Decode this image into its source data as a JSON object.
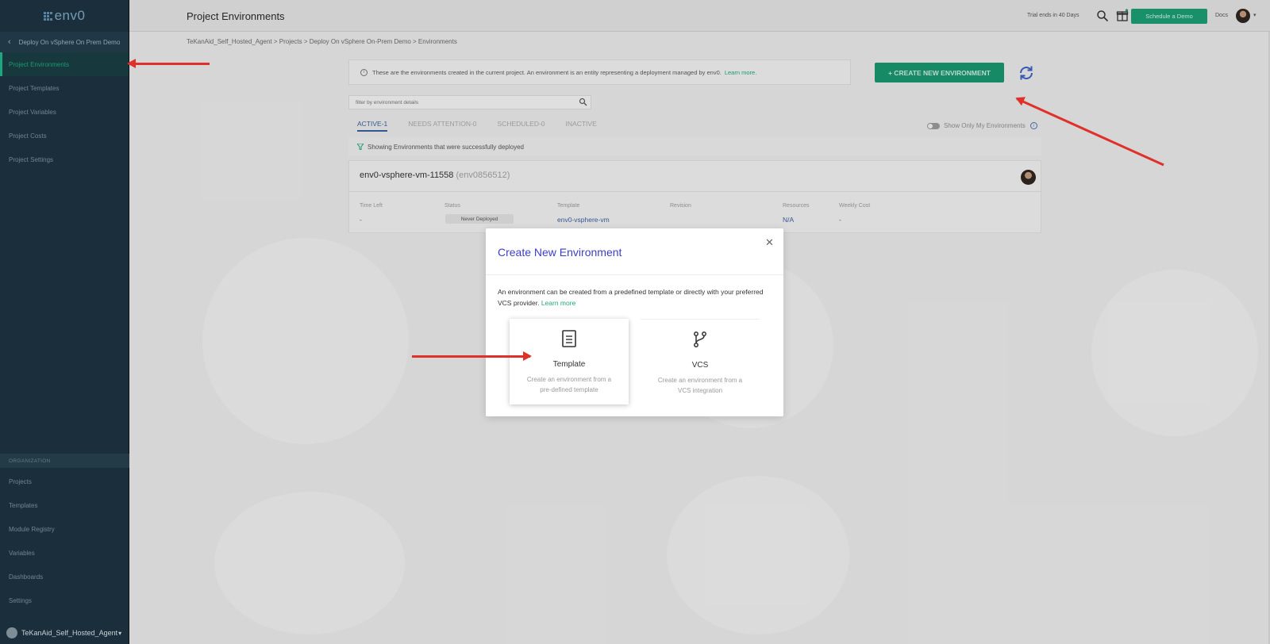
{
  "sidebar": {
    "logo": "env0",
    "project_name": "Deploy On vSphere On Prem Demo",
    "items": [
      {
        "label": "Project Environments",
        "active": true
      },
      {
        "label": "Project Templates"
      },
      {
        "label": "Project Variables"
      },
      {
        "label": "Project Costs"
      },
      {
        "label": "Project Settings"
      }
    ],
    "org_header": "ORGANIZATION",
    "org_items": [
      {
        "label": "Projects"
      },
      {
        "label": "Templates"
      },
      {
        "label": "Module Registry"
      },
      {
        "label": "Variables"
      },
      {
        "label": "Dashboards"
      },
      {
        "label": "Settings"
      }
    ],
    "org_name": "TeKanAid_Self_Hosted_Agent"
  },
  "topbar": {
    "title": "Project Environments",
    "trial_text": "Trial ends in 40 Days",
    "demo_button": "Schedule a Demo",
    "docs_link": "Docs"
  },
  "breadcrumb": "TeKanAid_Self_Hosted_Agent > Projects > Deploy On vSphere On-Prem Demo > Environments",
  "info": {
    "text": "These are the environments created in the current project. An environment is an entity representing a deployment managed by env0.",
    "learn_more": "Learn more."
  },
  "create_button": "+ CREATE NEW ENVIRONMENT",
  "filter": {
    "placeholder": "filter by environment details"
  },
  "tabs": [
    {
      "label": "ACTIVE-1",
      "active": true
    },
    {
      "label": "NEEDS ATTENTION-0"
    },
    {
      "label": "SCHEDULED-0"
    },
    {
      "label": "INACTIVE"
    }
  ],
  "toggle_label": "Show Only My Environments",
  "status_text": "Showing Environments that were successfully deployed",
  "environment": {
    "name": "env0-vsphere-vm-11558",
    "id": "(env0856512)",
    "columns": [
      {
        "label": "Time Left",
        "value": "-"
      },
      {
        "label": "Status",
        "value": "Never Deployed"
      },
      {
        "label": "Template",
        "value": "env0-vsphere-vm"
      },
      {
        "label": "Revision",
        "value": ""
      },
      {
        "label": "Resources",
        "value": "N/A"
      },
      {
        "label": "Weekly Cost",
        "value": "-"
      }
    ]
  },
  "modal": {
    "title": "Create New Environment",
    "description": "An environment can be created from a predefined template or directly with your preferred VCS provider.",
    "learn_more": "Learn more",
    "options": [
      {
        "label": "Template",
        "description": "Create an environment from a pre-defined template",
        "icon": "template-icon"
      },
      {
        "label": "VCS",
        "description": "Create an environment from a VCS integration",
        "icon": "git-branch-icon"
      }
    ]
  },
  "colors": {
    "sidebar_bg": "#1d3441",
    "accent_green": "#1b9d72",
    "modal_title": "#3c3ec9",
    "arrow_red": "#e0302a"
  }
}
